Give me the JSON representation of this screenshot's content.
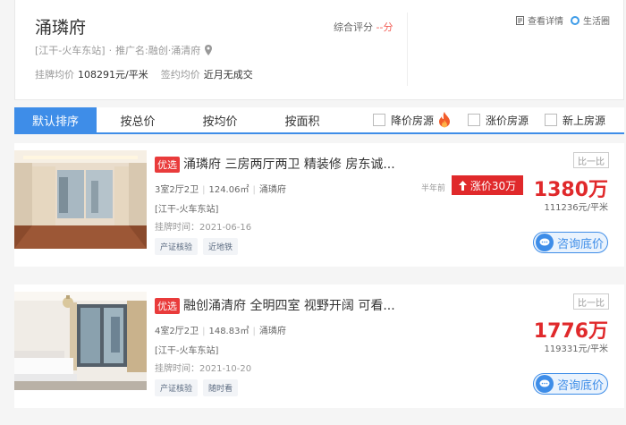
{
  "header": {
    "title": "涌璘府",
    "sub_location": "[江干-火车东站]",
    "sub_dot": "·",
    "sub_promo": "推广名:融创·涌清府",
    "avg_label": "挂牌均价",
    "avg_value": "108291元/平米",
    "sign_label": "签约均价",
    "sign_value": "近月无成交",
    "score_label": "综合评分",
    "score_value": "--分",
    "detail_link": "查看详情",
    "life_link": "生活圈"
  },
  "sort": {
    "tabs": [
      "默认排序",
      "按总价",
      "按均价",
      "按面积"
    ]
  },
  "filters": [
    "降价房源",
    "涨价房源",
    "新上房源"
  ],
  "listings": [
    {
      "badge": "优选",
      "title": "涌璘府 三房两厅两卫 精装修 房东诚...",
      "layout": "3室2厅2卫",
      "area": "124.06㎡",
      "community": "涌璘府",
      "location": "[江干-火车东站]",
      "date_label": "挂牌时间：2021-06-16",
      "tags": [
        "产证核验",
        "近地铁"
      ],
      "halfyear": "半年前",
      "rise": "涨价30万",
      "compare": "比一比",
      "price": "1380万",
      "unit_price": "111236元/平米",
      "consult": "咨询底价"
    },
    {
      "badge": "优选",
      "title": "融创涌清府 全明四室 视野开阔 可看...",
      "layout": "4室2厅2卫",
      "area": "148.83㎡",
      "community": "涌璘府",
      "location": "[江干-火车东站]",
      "date_label": "挂牌时间：2021-10-20",
      "tags": [
        "产证核验",
        "随时看"
      ],
      "compare": "比一比",
      "price": "1776万",
      "unit_price": "119331元/平米",
      "consult": "咨询底价"
    }
  ],
  "colors": {
    "accent": "#3e8de8",
    "price_red": "#e0292b",
    "badge_red": "#e93b3b"
  }
}
